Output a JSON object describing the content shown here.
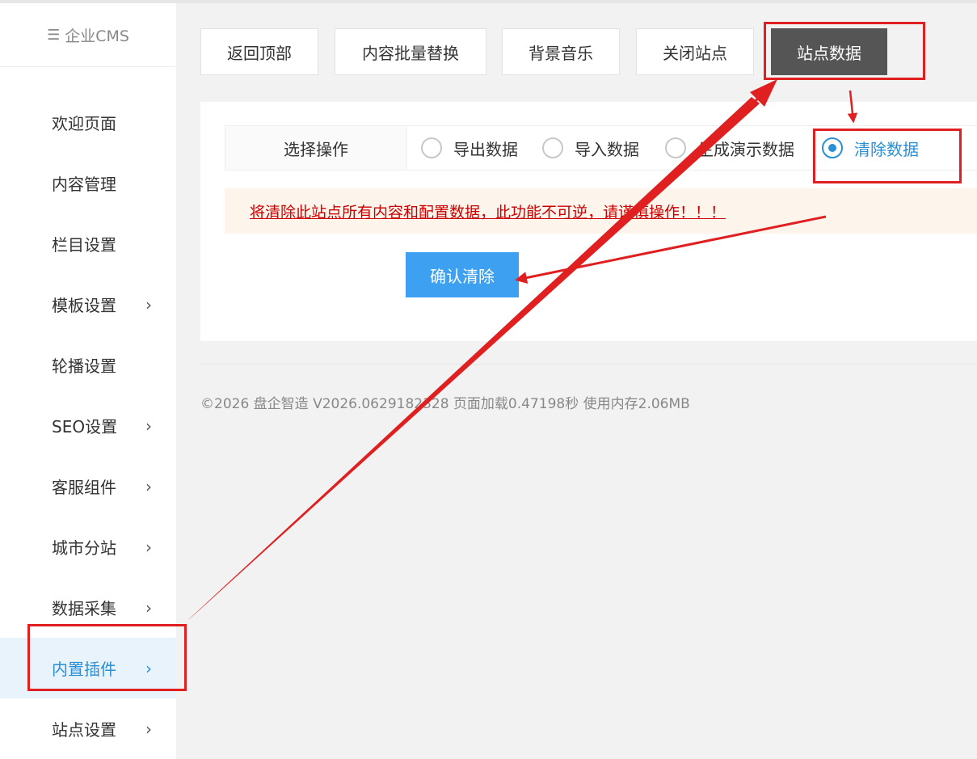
{
  "sidebar": {
    "logo": "企业CMS",
    "logo_icon": "menu-icon",
    "items": [
      {
        "label": "欢迎页面",
        "has_chevron": false,
        "active": false
      },
      {
        "label": "内容管理",
        "has_chevron": false,
        "active": false
      },
      {
        "label": "栏目设置",
        "has_chevron": false,
        "active": false
      },
      {
        "label": "模板设置",
        "has_chevron": true,
        "active": false
      },
      {
        "label": "轮播设置",
        "has_chevron": false,
        "active": false
      },
      {
        "label": "SEO设置",
        "has_chevron": true,
        "active": false
      },
      {
        "label": "客服组件",
        "has_chevron": true,
        "active": false
      },
      {
        "label": "城市分站",
        "has_chevron": true,
        "active": false
      },
      {
        "label": "数据采集",
        "has_chevron": true,
        "active": false
      },
      {
        "label": "内置插件",
        "has_chevron": true,
        "active": true
      },
      {
        "label": "站点设置",
        "has_chevron": true,
        "active": false
      }
    ]
  },
  "toolbar": {
    "back_to_top": "返回顶部",
    "batch_replace": "内容批量替换",
    "bg_music": "背景音乐",
    "close_site": "关闭站点",
    "site_data": "站点数据"
  },
  "operation": {
    "label": "选择操作",
    "options": [
      {
        "label": "导出数据",
        "checked": false
      },
      {
        "label": "导入数据",
        "checked": false
      },
      {
        "label": "生成演示数据",
        "checked": false
      },
      {
        "label": "清除数据",
        "checked": true
      }
    ]
  },
  "warning": "将清除此站点所有内容和配置数据，此功能不可逆，请谨慎操作！！！",
  "confirm_button": "确认清除",
  "footer": "©2026 盘企智造 V2026.0629182328 页面加载0.47198秒 使用内存2.06MB",
  "colors": {
    "accent": "#2a8fd4",
    "button": "#3ea0f0",
    "annotation": "#e02020",
    "warning_text": "#cc0000"
  }
}
